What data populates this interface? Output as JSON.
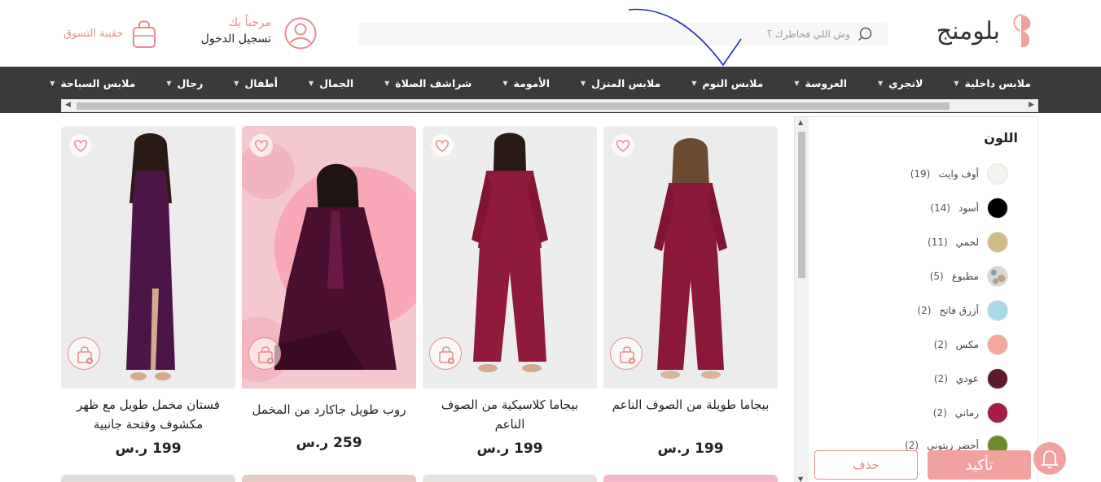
{
  "brand": {
    "name": "بلومنج",
    "accent": "#f2a29e"
  },
  "search": {
    "placeholder": "وش اللي فخاطرك ؟"
  },
  "account": {
    "greeting": "مرحباً بك",
    "login": "تسجيل الدخول"
  },
  "cart": {
    "label": "حقيبة التسوق"
  },
  "nav": [
    {
      "label": "ملابس داخلية"
    },
    {
      "label": "لانجري"
    },
    {
      "label": "العروسة"
    },
    {
      "label": "ملابس النوم"
    },
    {
      "label": "ملابس المنزل"
    },
    {
      "label": "الأمومة"
    },
    {
      "label": "شراشف الصلاة"
    },
    {
      "label": "الجمال"
    },
    {
      "label": "أطفال"
    },
    {
      "label": "رجال"
    },
    {
      "label": "ملابس السباحة"
    }
  ],
  "filter": {
    "title": "اللون",
    "colors": [
      {
        "name": "أوف وايت",
        "count": "(19)",
        "hex": "#f4f1ee"
      },
      {
        "name": "أسود",
        "count": "(14)",
        "hex": "#000000"
      },
      {
        "name": "لحمي",
        "count": "(11)",
        "hex": "#d2b98a"
      },
      {
        "name": "مطبوع",
        "count": "(5)",
        "hex": "#c9c3b8"
      },
      {
        "name": "أزرق فاتح",
        "count": "(2)",
        "hex": "#a8d8ea"
      },
      {
        "name": "مكس",
        "count": "(2)",
        "hex": "#f5a99a"
      },
      {
        "name": "عودي",
        "count": "(2)",
        "hex": "#5e1a2a"
      },
      {
        "name": "رماني",
        "count": "(2)",
        "hex": "#a31d45"
      },
      {
        "name": "أخضر زيتوني",
        "count": "(2)",
        "hex": "#6e8b2a"
      }
    ]
  },
  "products": [
    {
      "title": "بيجاما طويلة من الصوف الناعم",
      "price": "199 ر.س"
    },
    {
      "title": "بيجاما كلاسيكية من الصوف الناعم",
      "price": "199 ر.س"
    },
    {
      "title": "روب طويل جاكارد من المخمل",
      "price": "259 ر.س"
    },
    {
      "title": "فستان مخمل طويل مع ظهر مكشوف وفتحة جانبية",
      "price": "199 ر.س"
    }
  ],
  "actions": {
    "confirm": "تأكيد",
    "delete": "حذف"
  }
}
